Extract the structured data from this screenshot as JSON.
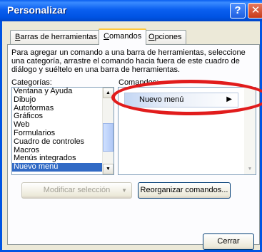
{
  "window": {
    "title": "Personalizar",
    "help_glyph": "?",
    "close_glyph": "✕"
  },
  "tabs": [
    {
      "label": "Barras de herramientas",
      "accel": "B",
      "rest": "arras de herramientas"
    },
    {
      "label": "Comandos",
      "accel": "C",
      "rest": "omandos"
    },
    {
      "label": "Opciones",
      "accel": "O",
      "rest": "pciones"
    }
  ],
  "instructions": "Para agregar un comando a una barra de herramientas, seleccione una categoría, arrastre el comando hacia fuera de este cuadro de diálogo y suéltelo en una barra de herramientas.",
  "categories": {
    "label": "Categorías:",
    "items": [
      "Ventana y Ayuda",
      "Dibujo",
      "Autoformas",
      "Gráficos",
      "Web",
      "Formularios",
      "Cuadro de controles",
      "Macros",
      "Menús integrados",
      "Nuevo menú"
    ],
    "selected": "Nuevo menú"
  },
  "commands": {
    "label": "Comandos:",
    "items": [
      {
        "label": "Nuevo menú",
        "arrow": "▶"
      }
    ]
  },
  "buttons": {
    "modify_selection": "Modificar selección",
    "modify_caret": "▼",
    "reorganize": "Reorganizar comandos...",
    "close": "Cerrar"
  },
  "colors": {
    "title_bar": "#0054e3",
    "selection": "#316ac5",
    "highlight_ellipse": "#e11c1c",
    "dialog_bg": "#ece9d8"
  }
}
